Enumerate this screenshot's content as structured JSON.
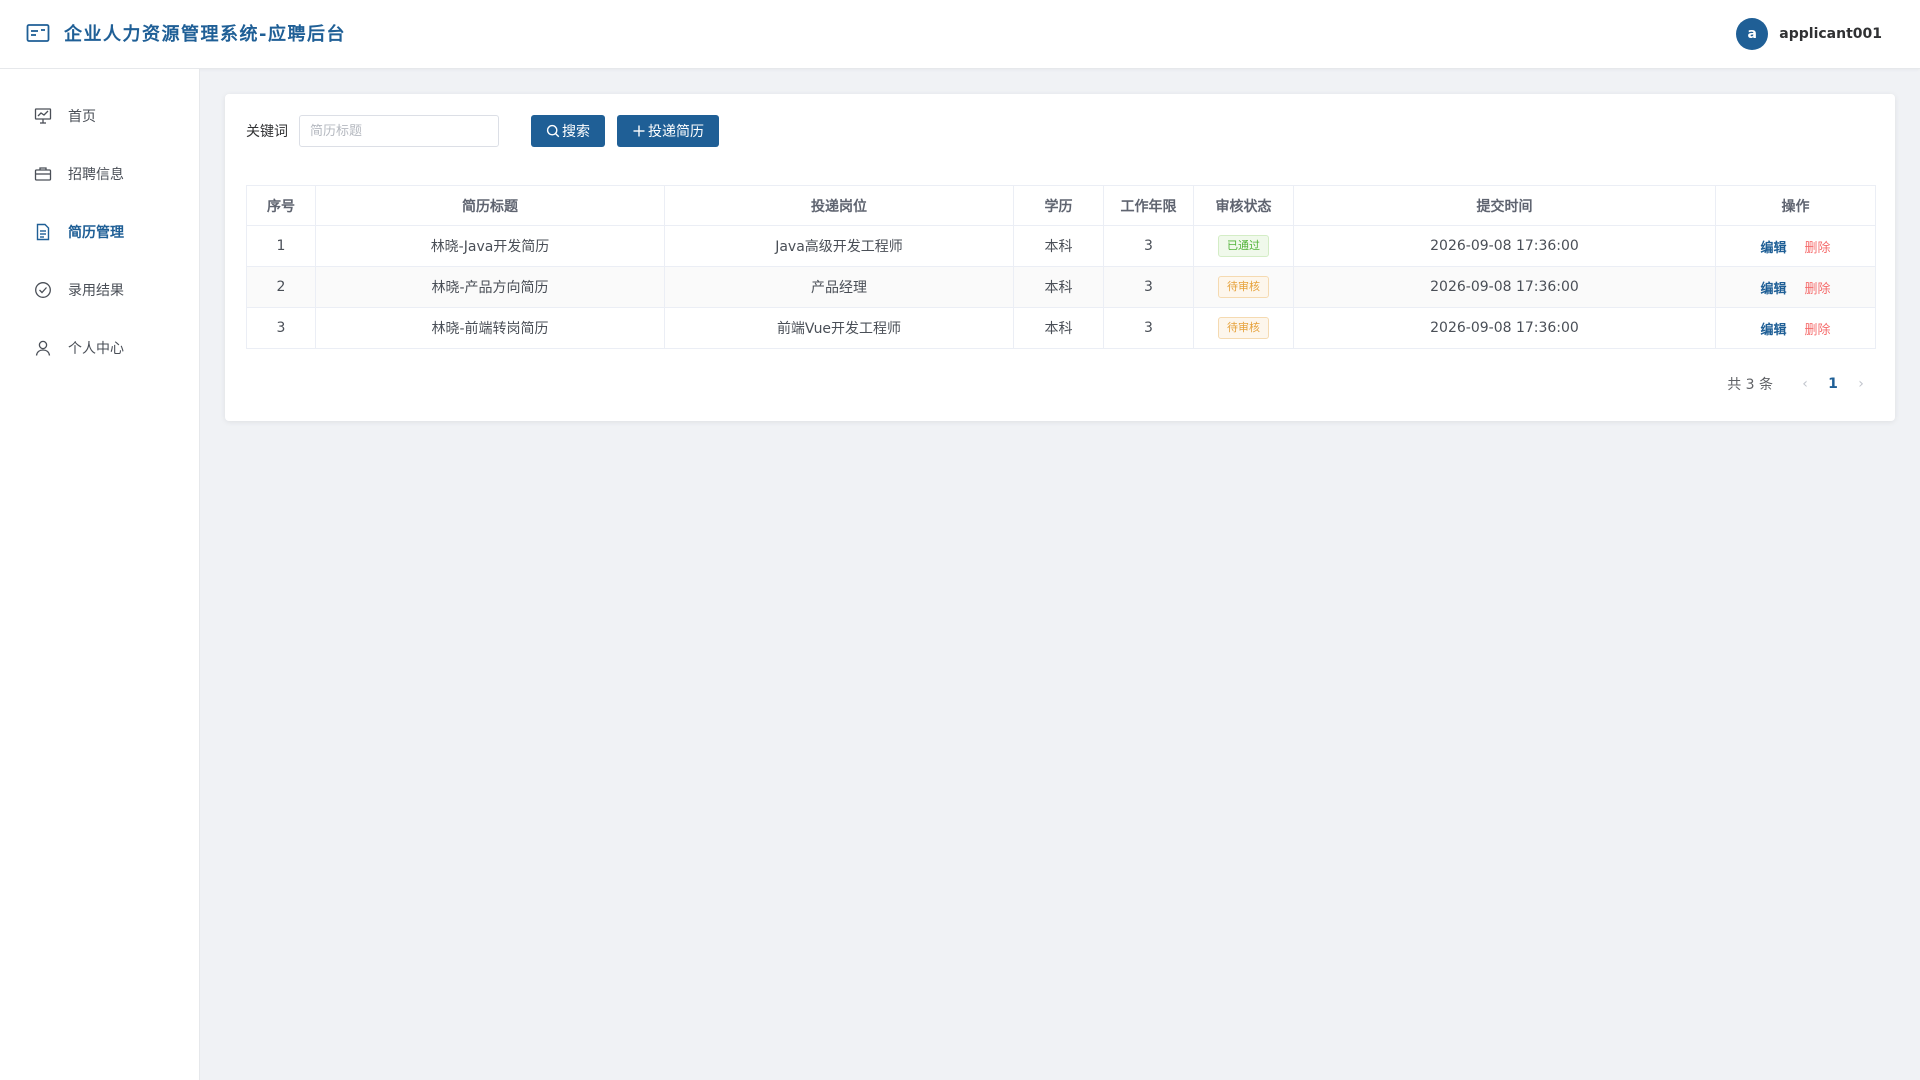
{
  "header": {
    "title": "企业人力资源管理系统-应聘后台",
    "avatar_letter": "a",
    "username": "applicant001"
  },
  "sidebar": {
    "items": [
      {
        "label": "首页",
        "icon": "presentation-icon"
      },
      {
        "label": "招聘信息",
        "icon": "briefcase-icon"
      },
      {
        "label": "简历管理",
        "icon": "document-icon"
      },
      {
        "label": "录用结果",
        "icon": "check-circle-icon"
      },
      {
        "label": "个人中心",
        "icon": "user-icon"
      }
    ],
    "active_index": 2
  },
  "toolbar": {
    "keyword_label": "关键词",
    "keyword_placeholder": "简历标题",
    "keyword_value": "",
    "search_label": "搜索",
    "add_label": "投递简历"
  },
  "table": {
    "headers": [
      "序号",
      "简历标题",
      "投递岗位",
      "学历",
      "工作年限",
      "审核状态",
      "提交时间",
      "操作"
    ],
    "rows": [
      {
        "index": "1",
        "title": "林晓-Java开发简历",
        "position": "Java高级开发工程师",
        "education": "本科",
        "years": "3",
        "status": "已通过",
        "status_type": "pass",
        "time": "2026-09-08 17:36:00",
        "edit": "编辑",
        "delete": "删除"
      },
      {
        "index": "2",
        "title": "林晓-产品方向简历",
        "position": "产品经理",
        "education": "本科",
        "years": "3",
        "status": "待审核",
        "status_type": "pending",
        "time": "2026-09-08 17:36:00",
        "edit": "编辑",
        "delete": "删除"
      },
      {
        "index": "3",
        "title": "林晓-前端转岗简历",
        "position": "前端Vue开发工程师",
        "education": "本科",
        "years": "3",
        "status": "待审核",
        "status_type": "pending",
        "time": "2026-09-08 17:36:00",
        "edit": "编辑",
        "delete": "删除"
      }
    ]
  },
  "pagination": {
    "total_text": "共 3 条",
    "current_page": "1",
    "prev_icon": "chevron-left-icon",
    "next_icon": "chevron-right-icon"
  },
  "colors": {
    "brand": "#1f5f96",
    "pass": "#52b43a",
    "pending": "#e6a23c",
    "danger": "#f56c6c"
  }
}
